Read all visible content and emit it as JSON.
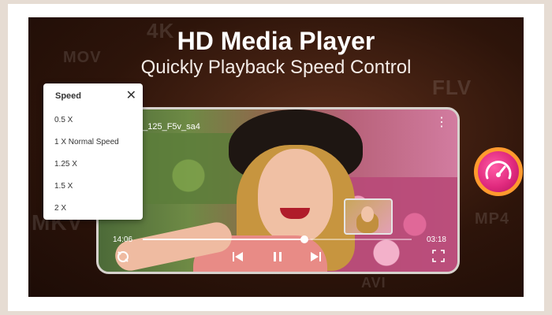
{
  "header": {
    "title": "HD Media Player",
    "subtitle": "Quickly Playback Speed Control"
  },
  "background_formats": [
    "4K",
    "MOV",
    "FLV",
    "MKV",
    "MP4",
    "AVI"
  ],
  "player": {
    "filename": "o_125_F5v_sa4",
    "current_time": "14:06",
    "total_time": "03:18",
    "progress": 0.6
  },
  "speed_menu": {
    "title": "Speed",
    "options": [
      "0.5 X",
      "1 X Normal Speed",
      "1.25 X",
      "1.5 X",
      "2 X"
    ]
  },
  "icons": {
    "close": "close-icon",
    "more": "more-vertical-icon",
    "rotate": "rotate-icon",
    "previous": "skip-previous-icon",
    "pause": "pause-icon",
    "next": "skip-next-icon",
    "fullscreen": "fullscreen-icon",
    "speedometer": "speedometer-icon"
  },
  "colors": {
    "accent_pink": "#e02a7e",
    "accent_orange": "#ff9a2e"
  }
}
